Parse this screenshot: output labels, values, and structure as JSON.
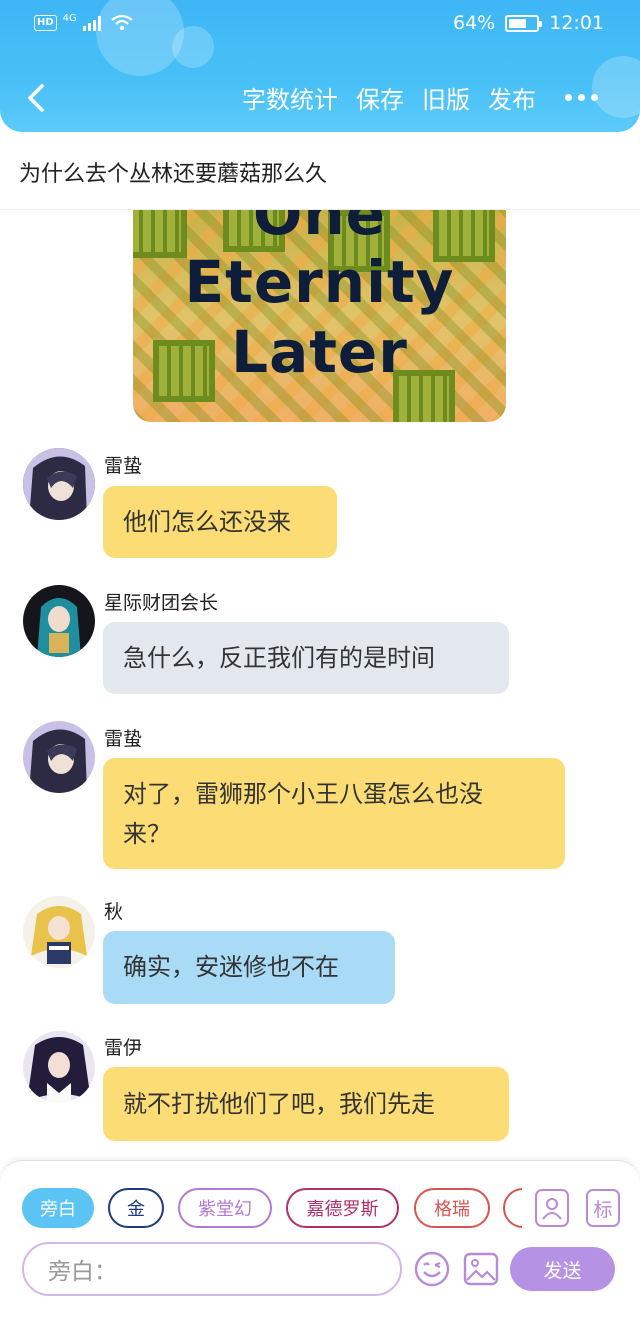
{
  "status_bar": {
    "signal_label": "4G",
    "hd_label": "HD",
    "battery_percent": "64%",
    "battery_level": 0.64,
    "time": "12:01"
  },
  "nav": {
    "back_icon": "chevron-left-icon",
    "actions": [
      "字数统计",
      "保存",
      "旧版",
      "发布"
    ],
    "more_icon": "more-dots-icon"
  },
  "title": "为什么去个丛林还要蘑菇那么久",
  "image_card": {
    "lines": [
      "One",
      "Eternity",
      "Later"
    ]
  },
  "messages": [
    {
      "name": "雷蛰",
      "text": "他们怎么还没来",
      "style": "yellow",
      "avatar": "avatar-dark-haired-character"
    },
    {
      "name": "星际财团会长",
      "text": "急什么，反正我们有的是时间",
      "style": "gray",
      "avatar": "avatar-teal-haired-character"
    },
    {
      "name": "雷蛰",
      "text_lines": [
        "对了，雷狮那个小王八蛋怎么也没",
        "来？"
      ],
      "style": "yellow",
      "avatar": "avatar-dark-haired-character"
    },
    {
      "name": "秋",
      "text": "确实，安迷修也不在",
      "style": "blue",
      "avatar": "avatar-blonde-character"
    },
    {
      "name": "雷伊",
      "text": "就不打扰他们了吧，我们先走",
      "style": "yellow",
      "avatar": "avatar-black-haired-character"
    }
  ],
  "composer": {
    "chips": [
      {
        "label": "旁白",
        "color": "#5bc4f5",
        "filled": true
      },
      {
        "label": "金",
        "color": "#1f3b7a",
        "filled": false
      },
      {
        "label": "紫堂幻",
        "color": "#b07ad6",
        "filled": false
      },
      {
        "label": "嘉德罗斯",
        "color": "#b0306a",
        "filled": false
      },
      {
        "label": "格瑞",
        "color": "#d9534f",
        "filled": false
      }
    ],
    "character_icon": "person-card-icon",
    "tag_label": "标",
    "input_placeholder": "旁白：",
    "emoji_icon": "emoji-wink-icon",
    "image_icon": "image-icon",
    "send_label": "发送"
  },
  "colors": {
    "header": "#45bdf6",
    "bubble_yellow": "#fcdc74",
    "bubble_gray": "#e3e8ef",
    "bubble_blue": "#a9dbf6",
    "accent_purple": "#b592e3"
  }
}
